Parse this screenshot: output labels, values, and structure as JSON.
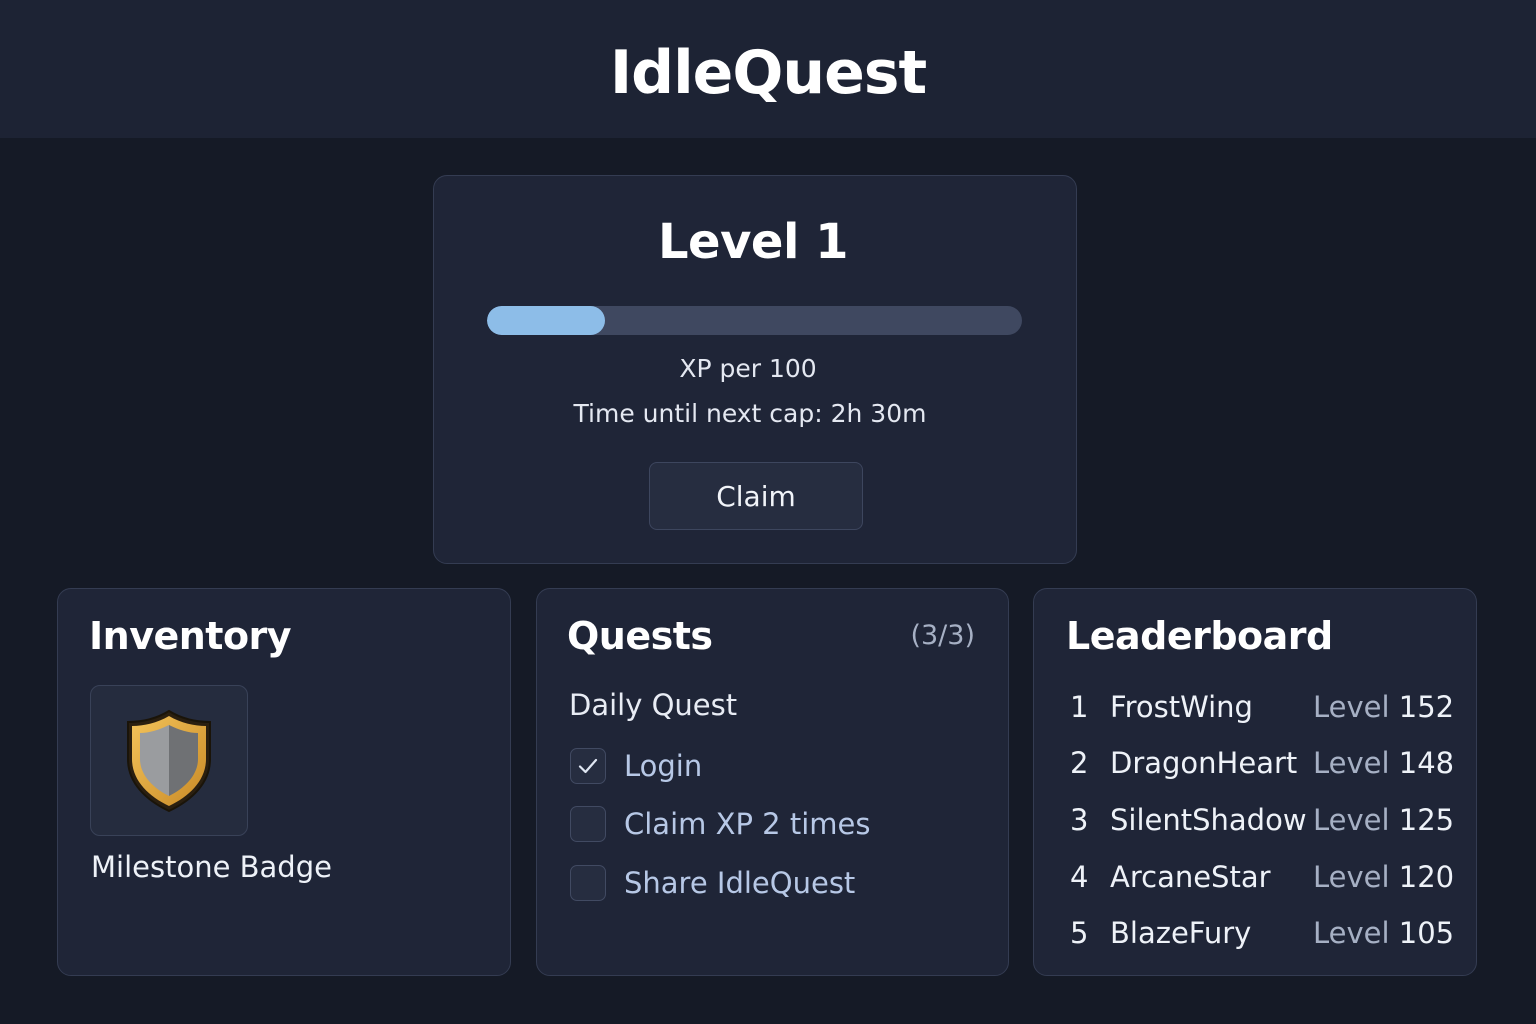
{
  "app": {
    "title": "IdleQuest"
  },
  "level_card": {
    "title": "Level 1",
    "xp_progress_fraction": 0.22,
    "xp_text": "XP per 100",
    "cap_text": "Time until next cap: 2h 30m",
    "claim_label": "Claim"
  },
  "inventory": {
    "title": "Inventory",
    "items": [
      {
        "name": "Milestone Badge",
        "icon": "shield-icon"
      }
    ]
  },
  "quests": {
    "title": "Quests",
    "count": "(3/3)",
    "subtitle": "Daily Quest",
    "items": [
      {
        "label": "Login",
        "checked": true
      },
      {
        "label": "Claim XP 2 times",
        "checked": false
      },
      {
        "label": "Share IdleQuest",
        "checked": false
      }
    ]
  },
  "leaderboard": {
    "title": "Leaderboard",
    "level_word": "Level",
    "rows": [
      {
        "rank": "1",
        "name": "FrostWing",
        "level": "152"
      },
      {
        "rank": "2",
        "name": "DragonHeart",
        "level": "148"
      },
      {
        "rank": "3",
        "name": "SilentShadow",
        "level": "125"
      },
      {
        "rank": "4",
        "name": "ArcaneStar",
        "level": "120"
      },
      {
        "rank": "5",
        "name": "BlazeFury",
        "level": "105"
      }
    ]
  },
  "colors": {
    "background": "#151a26",
    "header": "#1d2334",
    "panel": "#1f2537",
    "xp_fill": "#8dbde8",
    "shield_gold": "#e0a83e"
  }
}
